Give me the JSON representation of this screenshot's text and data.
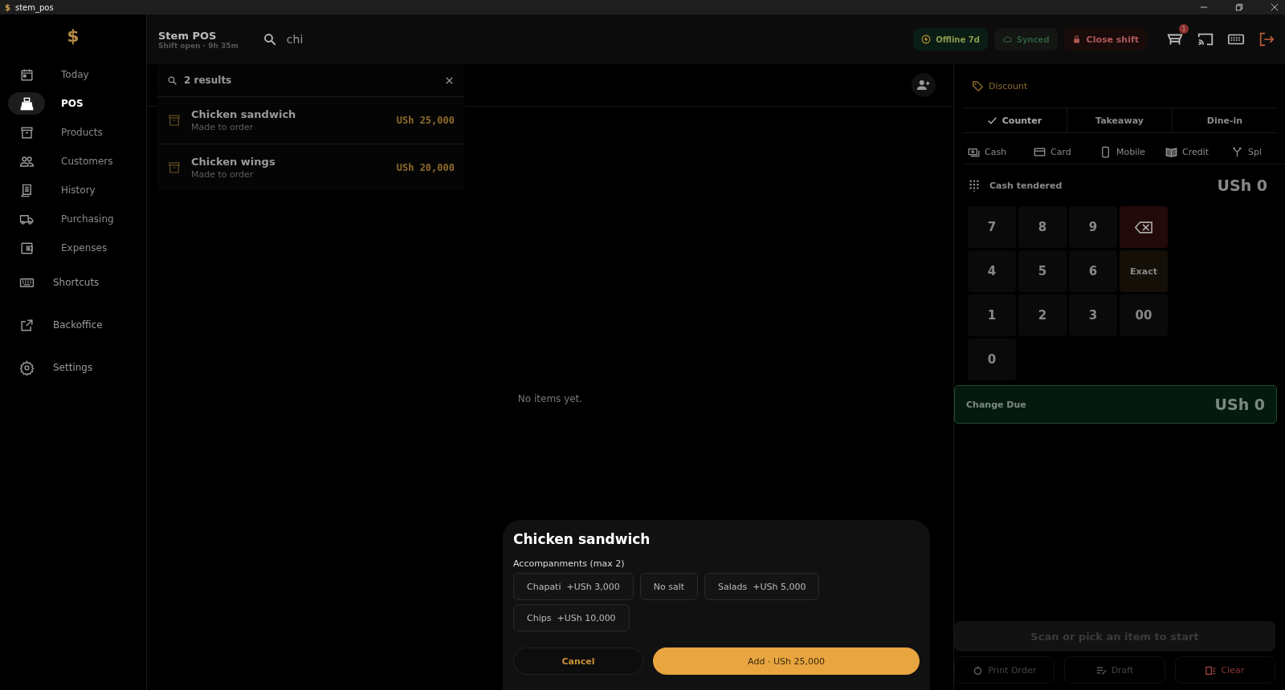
{
  "window": {
    "title": "stem_pos",
    "icon": "$"
  },
  "sidebar": {
    "logo": "$",
    "items": [
      {
        "label": "Today",
        "selected": false
      },
      {
        "label": "POS",
        "selected": true
      },
      {
        "label": "Products",
        "selected": false
      },
      {
        "label": "Customers",
        "selected": false
      },
      {
        "label": "History",
        "selected": false
      },
      {
        "label": "Purchasing",
        "selected": false
      },
      {
        "label": "Expenses",
        "selected": false
      },
      {
        "label": "Shortcuts",
        "selected": false
      },
      {
        "label": "Backoffice",
        "selected": false
      },
      {
        "label": "Settings",
        "selected": false
      }
    ]
  },
  "header": {
    "title": "Stem POS",
    "subtitle": "Shift open · 9h 35m",
    "search": "chi",
    "status": [
      {
        "label": "Offline 7d",
        "kind": "offline"
      },
      {
        "label": "Synced",
        "kind": "synced"
      },
      {
        "label": "Close shift",
        "kind": "close"
      }
    ],
    "cart_badge": "1"
  },
  "results": {
    "count": "2 results",
    "items": [
      {
        "name": "Chicken sandwich",
        "note": "Made to order",
        "price": "USh 25,000"
      },
      {
        "name": "Chicken wings",
        "note": "Made to order",
        "price": "USh 20,000"
      }
    ]
  },
  "order": {
    "empty": "No items yet."
  },
  "panel": {
    "discount": "Discount",
    "order_types": [
      {
        "label": "Counter",
        "selected": true
      },
      {
        "label": "Takeaway",
        "selected": false
      },
      {
        "label": "Dine-in",
        "selected": false
      }
    ],
    "payments": [
      "Cash",
      "Card",
      "Mobile",
      "Credit",
      "Spl"
    ],
    "tendered_label": "Cash tendered",
    "tendered": "USh 0",
    "keys": [
      {
        "kind": "digit",
        "label": "7"
      },
      {
        "kind": "digit",
        "label": "8"
      },
      {
        "kind": "digit",
        "label": "9"
      },
      {
        "kind": "backspace"
      },
      {
        "kind": "digit",
        "label": "4"
      },
      {
        "kind": "digit",
        "label": "5"
      },
      {
        "kind": "digit",
        "label": "6"
      },
      {
        "kind": "exact",
        "label": "Exact"
      },
      {
        "kind": "digit",
        "label": "1"
      },
      {
        "kind": "digit",
        "label": "2"
      },
      {
        "kind": "digit",
        "label": "3"
      },
      {
        "kind": "digit",
        "label": "00"
      },
      {
        "kind": "digit",
        "label": "0"
      }
    ],
    "change_label": "Change Due",
    "change": "USh 0",
    "scan": "Scan or pick an item to start",
    "actions": [
      {
        "label": "Print Order",
        "kind": "print"
      },
      {
        "label": "Draft",
        "kind": "draft"
      },
      {
        "label": "Clear",
        "kind": "clear"
      }
    ]
  },
  "dialog": {
    "title": "Chicken sandwich",
    "group": "Accompanments (max 2)",
    "options": [
      {
        "name": "Chapati",
        "price": "+USh 3,000"
      },
      {
        "name": "No salt"
      },
      {
        "name": "Salads",
        "price": "+USh 5,000"
      },
      {
        "name": "Chips",
        "price": "+USh 10,000"
      }
    ],
    "cancel": "Cancel",
    "add": "Add · USh 25,000"
  }
}
